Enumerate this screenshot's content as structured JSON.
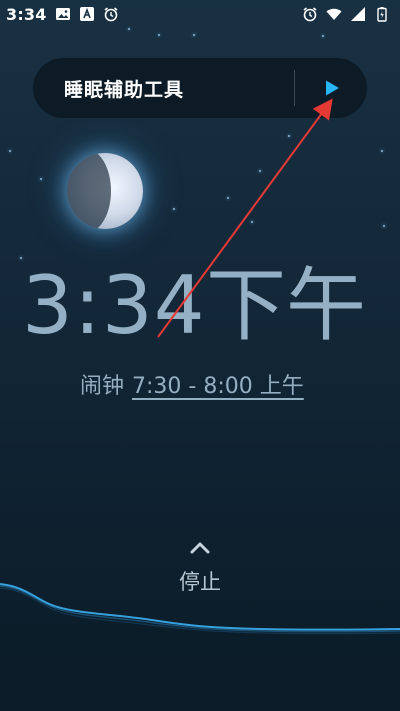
{
  "status_bar": {
    "time": "3:34",
    "left_icons": [
      "image-icon",
      "a-square-icon",
      "alarm-clock-icon"
    ],
    "right_icons": [
      "alarm-clock-icon",
      "wifi-icon",
      "signal-icon",
      "battery-charging-icon"
    ]
  },
  "sleep_aid": {
    "title": "睡眠辅助工具",
    "play_icon": "play-icon",
    "accent_color": "#29b6f6"
  },
  "clock": {
    "time": "3:34",
    "ampm": "下午"
  },
  "alarm": {
    "label": "闹钟",
    "range": "7:30 - 8:00 上午"
  },
  "stop": {
    "label": "停止",
    "icon": "chevron-up-icon"
  },
  "colors": {
    "annotation_arrow": "#e53935",
    "wave": "#3aa9e8"
  }
}
